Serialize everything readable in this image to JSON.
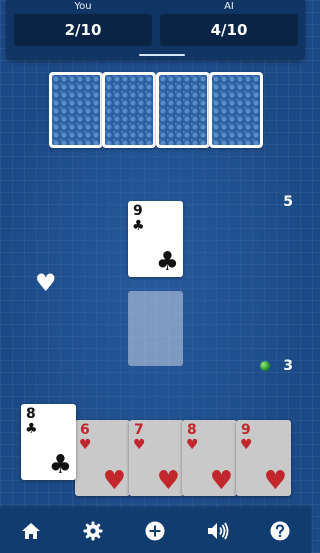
{
  "scoreboard": {
    "you": {
      "name": "You",
      "score": "2/10"
    },
    "ai": {
      "name": "AI",
      "score": "4/10"
    }
  },
  "opponent_hand": {
    "cards_face_down": 4
  },
  "table": {
    "played_card": {
      "rank": "9",
      "suit": "♣",
      "color": "black"
    },
    "upper_count": "5",
    "lower_count": "3",
    "trump_suit_icon": "heart-icon"
  },
  "player_hand": [
    {
      "rank": "8",
      "suit": "♣",
      "color": "black"
    },
    {
      "rank": "6",
      "suit": "♥",
      "color": "red"
    },
    {
      "rank": "7",
      "suit": "♥",
      "color": "red"
    },
    {
      "rank": "8",
      "suit": "♥",
      "color": "red"
    },
    {
      "rank": "9",
      "suit": "♥",
      "color": "red"
    }
  ],
  "toolbar": [
    "home-icon",
    "settings-gear-icon",
    "add-circle-icon",
    "sound-icon",
    "help-icon"
  ],
  "colors": {
    "background": "#1c4a86",
    "panel": "#103565",
    "score_box": "#0a2446",
    "red_suit": "#c1272d"
  }
}
